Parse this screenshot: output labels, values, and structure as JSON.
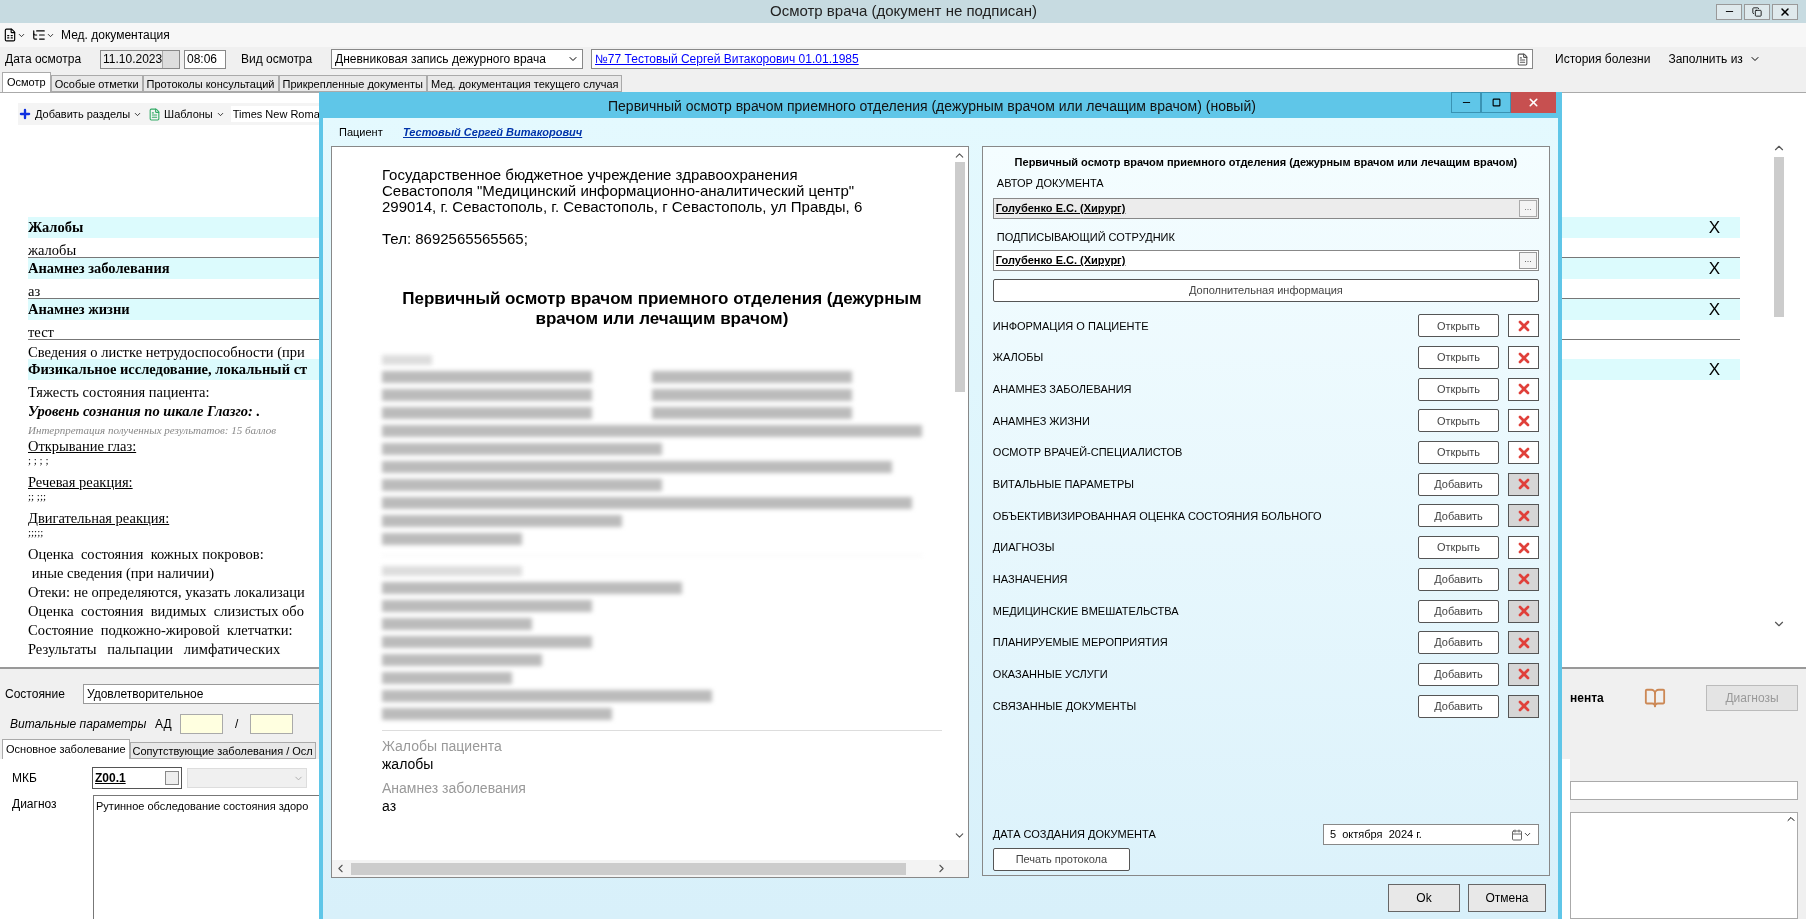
{
  "window": {
    "title": "Осмотр врача (документ не подписан)"
  },
  "toolbar": {
    "menu_label": "Мед. документация"
  },
  "header": {
    "date_label": "Дата осмотра",
    "date": "11.10.2023",
    "time": "08:06",
    "type_label": "Вид осмотра",
    "type": "Дневниковая запись дежурного врача",
    "patient": "№77 Тестовый Сергей Витакорович 01.01.1985",
    "history": "История болезни",
    "fill_from": "Заполнить из"
  },
  "tabs": [
    {
      "label": "Осмотр",
      "selected": true
    },
    {
      "label": "Особые отметки",
      "selected": false
    },
    {
      "label": "Протоколы консультаций",
      "selected": false
    },
    {
      "label": "Прикрепленные документы",
      "selected": false
    },
    {
      "label": "Мед. документация текущего случая",
      "selected": false
    }
  ],
  "editor_toolbar": {
    "add_sections": "Добавить разделы",
    "templates": "Шаблоны",
    "font": "Times New Roma"
  },
  "document": [
    {
      "kind": "heading",
      "text": "Жалобы",
      "close": "X"
    },
    {
      "kind": "value",
      "text": "жалобы"
    },
    {
      "kind": "heading",
      "text": "Анамнез заболевания",
      "close": "X"
    },
    {
      "kind": "value",
      "text": "аз"
    },
    {
      "kind": "heading",
      "text": "Анамнез жизни",
      "close": "X"
    },
    {
      "kind": "value",
      "text": "тест"
    },
    {
      "kind": "plain",
      "text": "Сведения о листке нетрудоспособности (при"
    },
    {
      "kind": "heading",
      "text": "Физикальное исследование, локальный ст",
      "close": "X"
    },
    {
      "kind": "plain",
      "text": "Тяжесть состояния пациента:"
    },
    {
      "kind": "emph",
      "text": "Уровень сознания по шкале Глазго: ."
    },
    {
      "kind": "note",
      "text": "Интерпретация полученных результатов: 15 баллов"
    },
    {
      "kind": "underline",
      "text": "Открывание глаз:"
    },
    {
      "kind": "dots",
      "text": "; ; ; ;"
    },
    {
      "kind": "underline",
      "text": "Речевая реакция:"
    },
    {
      "kind": "dots",
      "text": ";; ;;;"
    },
    {
      "kind": "underline",
      "text": "Двигательная реакция:"
    },
    {
      "kind": "dots",
      "text": ";;;;;"
    },
    {
      "kind": "plain",
      "text": "Оценка  состояния  кожных покровов:"
    },
    {
      "kind": "plain",
      "text": " иные сведения (при наличии)"
    },
    {
      "kind": "plain",
      "text": "Отеки: не определяются, указать локализаци"
    },
    {
      "kind": "plain",
      "text": "Оценка  состояния  видимых  слизистых обо"
    },
    {
      "kind": "plain",
      "text": "Состояние  подкожно-жировой  клетчатки:"
    },
    {
      "kind": "plain",
      "text": "Результаты   пальпации   лимфатических"
    }
  ],
  "bottom": {
    "state_label": "Состояние",
    "state": "Удовлетворительное",
    "vitals_label": "Витальные параметры",
    "bp_label": "АД",
    "bp_sep": "/",
    "tabs": [
      {
        "label": "Основное заболевание",
        "selected": true
      },
      {
        "label": "Сопутствующие заболевания / Осл",
        "selected": false
      }
    ],
    "icd_label": "МКБ",
    "icd": "Z00.1",
    "diagnosis_label": "Диагноз",
    "diagnosis": "Рутинное обследование состояния здоро",
    "right_label": "нента",
    "diagnoses_button": "Диагнозы"
  },
  "dialog": {
    "title": "Первичный осмотр врачом приемного отделения (дежурным врачом или лечащим врачом) (новый)",
    "patient_label": "Пациент",
    "patient": "Тестовый Сергей Витакорович",
    "preview": {
      "org": [
        "Государственное бюджетное учреждение здравоохранения",
        "Севастополя \"Медицинский информационно-аналитический центр\"",
        "299014, г. Севастополь, г. Севастополь, г Севастополь, ул Правды, 6"
      ],
      "phone": "Тел: 8692565565565;",
      "title": "Первичный осмотр врачом приемного отделения (дежурным врачом или лечащим врачом)",
      "fields": [
        {
          "label": "Жалобы пациента",
          "value": "жалобы"
        },
        {
          "label": "Анамнез заболевания",
          "value": "аз"
        }
      ]
    },
    "panel": {
      "title": "Первичный осмотр врачом приемного отделения (дежурным врачом или лечащим врачом)",
      "author_label": "АВТОР ДОКУМЕНТА",
      "author": "Голубенко Е.С. (Хирург)",
      "signer_label": "ПОДПИСЫВАЮЩИЙ СОТРУДНИК",
      "signer": "Голубенко Е.С. (Хирург)",
      "more_button": "Дополнительная информация",
      "browse": "...",
      "sections": [
        {
          "label": "ИНФОРМАЦИЯ О ПАЦИЕНТЕ",
          "button": "Открыть",
          "removable": true
        },
        {
          "label": "ЖАЛОБЫ",
          "button": "Открыть",
          "removable": true
        },
        {
          "label": "АНАМНЕЗ ЗАБОЛЕВАНИЯ",
          "button": "Открыть",
          "removable": true
        },
        {
          "label": "АНАМНЕЗ ЖИЗНИ",
          "button": "Открыть",
          "removable": true
        },
        {
          "label": "ОСМОТР ВРАЧЕЙ-СПЕЦИАЛИСТОВ",
          "button": "Открыть",
          "removable": true
        },
        {
          "label": "ВИТАЛЬНЫЕ ПАРАМЕТРЫ",
          "button": "Добавить",
          "removable": false
        },
        {
          "label": "ОБЪЕКТИВИЗИРОВАННАЯ ОЦЕНКА СОСТОЯНИЯ БОЛЬНОГО",
          "button": "Добавить",
          "removable": false
        },
        {
          "label": "ДИАГНОЗЫ",
          "button": "Открыть",
          "removable": true
        },
        {
          "label": "НАЗНАЧЕНИЯ",
          "button": "Добавить",
          "removable": false
        },
        {
          "label": "МЕДИЦИНСКИЕ ВМЕШАТЕЛЬСТВА",
          "button": "Добавить",
          "removable": false
        },
        {
          "label": "ПЛАНИРУЕМЫЕ МЕРОПРИЯТИЯ",
          "button": "Добавить",
          "removable": false
        },
        {
          "label": "ОКАЗАННЫЕ УСЛУГИ",
          "button": "Добавить",
          "removable": false
        },
        {
          "label": "СВЯЗАННЫЕ ДОКУМЕНТЫ",
          "button": "Добавить",
          "removable": false
        }
      ],
      "date_label": "ДАТА СОЗДАНИЯ ДОКУМЕНТА",
      "date": "5  октября  2024 г.",
      "print_button": "Печать протокола"
    },
    "ok": "Ok",
    "cancel": "Отмена"
  }
}
